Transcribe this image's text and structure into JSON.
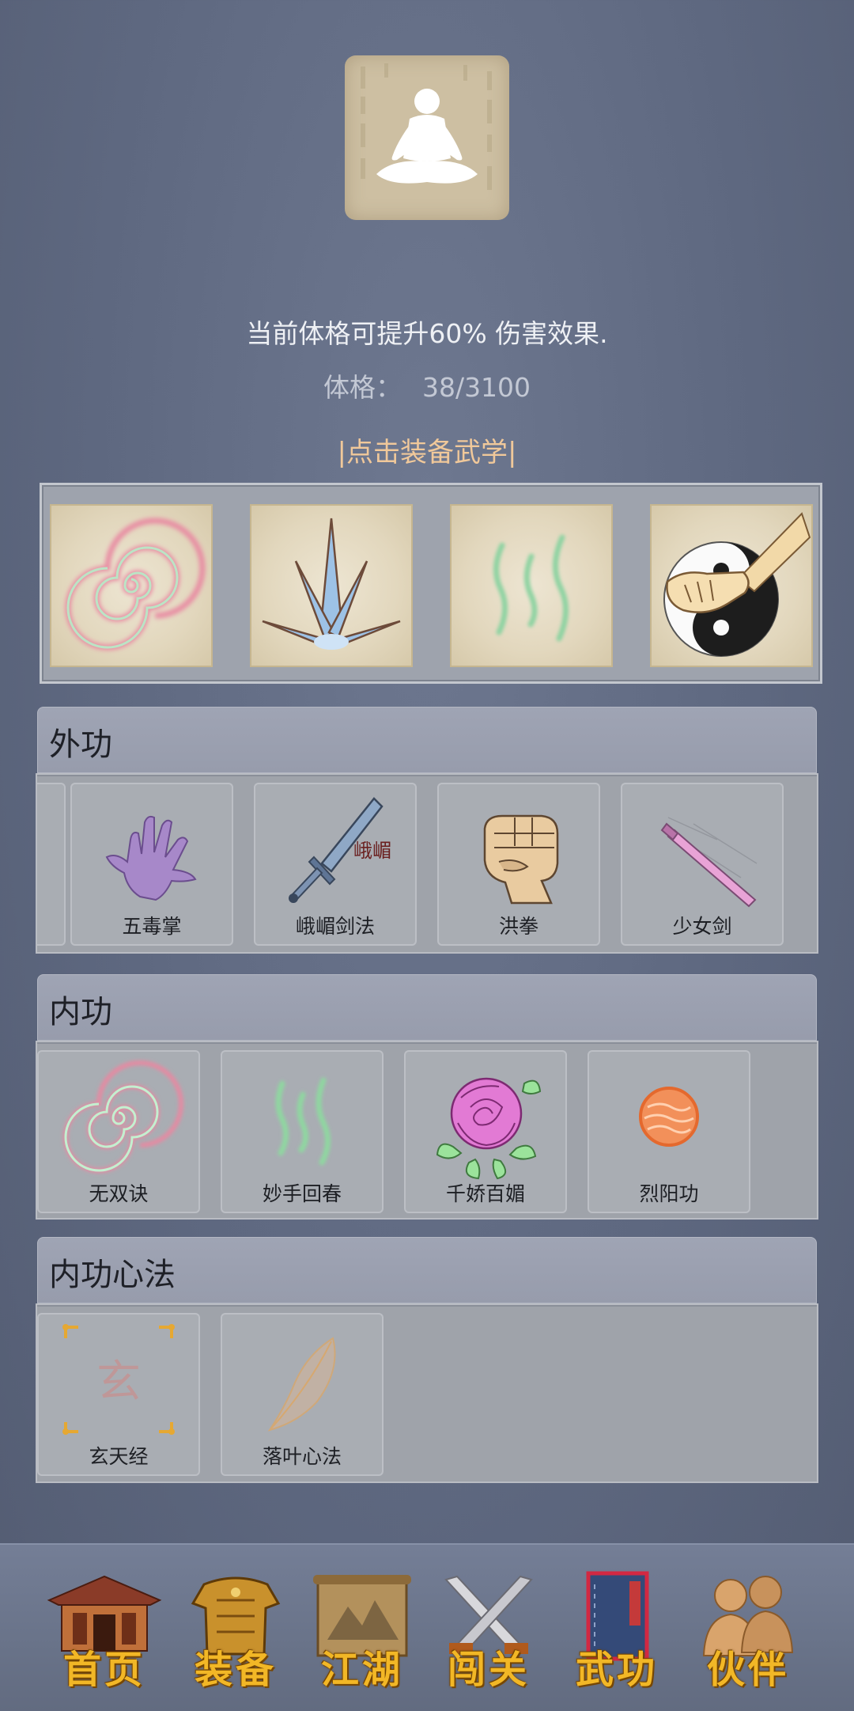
{
  "header": {
    "portrait_icon": "meditation-figure-icon",
    "description": "当前体格可提升60% 伤害效果.",
    "stat_label": "体格：",
    "stat_value": "38/3100",
    "equip_link": "|点击装备武学|"
  },
  "equipped_slots": [
    {
      "icon": "spiral-qi-icon"
    },
    {
      "icon": "ice-crystal-icon"
    },
    {
      "icon": "green-wave-icon"
    },
    {
      "icon": "taiji-fist-icon"
    }
  ],
  "sections": {
    "waigong": {
      "title": "外功",
      "items": [
        {
          "label": "五毒掌",
          "icon": "purple-hand-icon"
        },
        {
          "label": "峨嵋剑法",
          "icon": "emei-sword-icon",
          "icon_text": "峨嵋"
        },
        {
          "label": "洪拳",
          "icon": "fist-icon"
        },
        {
          "label": "少女剑",
          "icon": "pink-sword-icon"
        }
      ]
    },
    "neigong": {
      "title": "内功",
      "items": [
        {
          "label": "无双诀",
          "icon": "spiral-qi-icon"
        },
        {
          "label": "妙手回春",
          "icon": "green-wave-icon"
        },
        {
          "label": "千娇百媚",
          "icon": "rose-icon"
        },
        {
          "label": "烈阳功",
          "icon": "sun-orb-icon"
        }
      ]
    },
    "xinfa": {
      "title": "内功心法",
      "items": [
        {
          "label": "玄天经",
          "icon": "xuan-scroll-icon",
          "icon_text": "玄"
        },
        {
          "label": "落叶心法",
          "icon": "falling-leaf-icon"
        }
      ]
    }
  },
  "nav": [
    {
      "label": "首页",
      "icon": "temple-icon"
    },
    {
      "label": "装备",
      "icon": "armor-icon"
    },
    {
      "label": "江湖",
      "icon": "scroll-map-icon"
    },
    {
      "label": "闯关",
      "icon": "crossed-swords-icon"
    },
    {
      "label": "武功",
      "icon": "martial-book-icon"
    },
    {
      "label": "伙伴",
      "icon": "partners-icon"
    }
  ]
}
